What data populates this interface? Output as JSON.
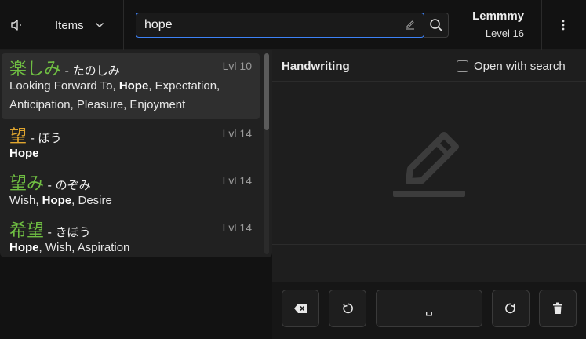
{
  "topbar": {
    "items_label": "Items",
    "search": {
      "value": "hope",
      "placeholder": ""
    },
    "user": {
      "name": "Lemmmy",
      "level": "Level 16"
    }
  },
  "results": [
    {
      "kanji": "楽しみ",
      "kana": "- たのしみ",
      "level": "Lvl 10",
      "color": "#6fbe42",
      "meaning_parts": [
        "Looking Forward To, ",
        "Hope",
        ", Expectation,"
      ],
      "meaning_line2": "Anticipation, Pleasure, Enjoyment"
    },
    {
      "kanji": "望",
      "kana": "- ぼう",
      "level": "Lvl 14",
      "color": "#e0a52e",
      "meaning_parts": [
        "",
        "Hope",
        ""
      ]
    },
    {
      "kanji": "望み",
      "kana": "- のぞみ",
      "level": "Lvl 14",
      "color": "#6fbe42",
      "meaning_parts": [
        "Wish, ",
        "Hope",
        ", Desire"
      ]
    },
    {
      "kanji": "希望",
      "kana": "- きぼう",
      "level": "Lvl 14",
      "color": "#6fbe42",
      "meaning_parts": [
        "",
        "Hope",
        ", Wish, Aspiration"
      ]
    }
  ],
  "handwriting": {
    "title": "Handwriting",
    "open_with_search_label": "Open with search",
    "open_with_search_checked": false
  },
  "toolbar": {
    "backspace_icon": "backspace-icon",
    "undo_icon": "undo-icon",
    "space_glyph": "␣",
    "redo_icon": "redo-icon",
    "clear_icon": "trash-icon"
  },
  "colors": {
    "accent": "#3d82f7",
    "green": "#6fbe42",
    "gold": "#e0a52e"
  }
}
